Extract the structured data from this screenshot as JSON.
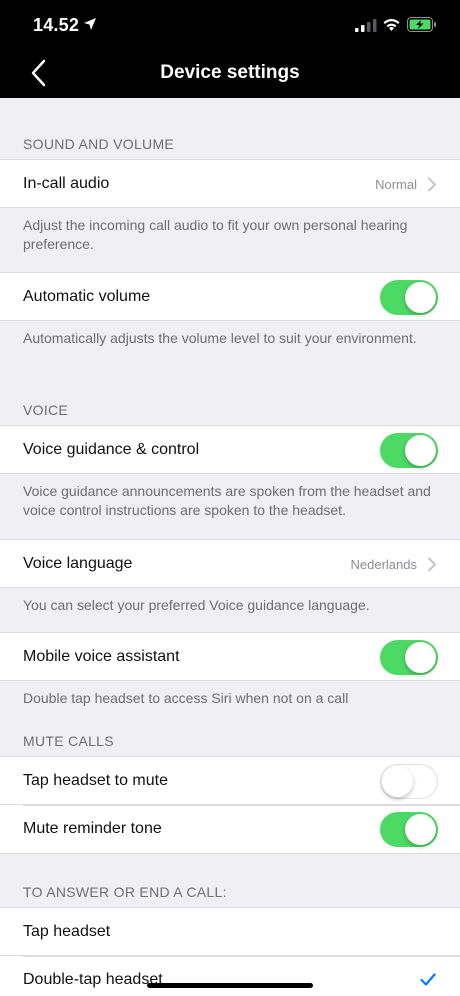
{
  "status_bar": {
    "time": "14.52"
  },
  "nav": {
    "title": "Device settings"
  },
  "sections": {
    "sound": {
      "header": "SOUND AND VOLUME",
      "in_call_audio": {
        "label": "In-call audio",
        "value": "Normal"
      },
      "in_call_note": "Adjust the incoming call audio to fit your own personal hearing preference.",
      "auto_volume": {
        "label": "Automatic volume",
        "on": true
      },
      "auto_volume_note": "Automatically adjusts the volume level to suit your environment."
    },
    "voice": {
      "header": "VOICE",
      "guidance": {
        "label": "Voice guidance & control",
        "on": true
      },
      "guidance_note": "Voice guidance announcements are spoken from the headset and voice control instructions are spoken to the headset.",
      "language": {
        "label": "Voice language",
        "value": "Nederlands"
      },
      "language_note": "You can select your preferred Voice guidance language.",
      "assistant": {
        "label": "Mobile voice assistant",
        "on": true
      },
      "assistant_note": "Double tap headset to access Siri when not on a call"
    },
    "mute": {
      "header": "MUTE CALLS",
      "tap_mute": {
        "label": "Tap headset to mute",
        "on": false
      },
      "reminder": {
        "label": "Mute reminder tone",
        "on": true
      }
    },
    "answer": {
      "header": "TO ANSWER OR END A CALL:",
      "tap": {
        "label": "Tap headset"
      },
      "double_tap": {
        "label": "Double-tap headset",
        "selected": true
      }
    }
  },
  "colors": {
    "toggle_on": "#4cd964",
    "check": "#007aff",
    "nav_bg": "#000000"
  },
  "icons": [
    "location-arrow-icon",
    "signal-icon",
    "wifi-icon",
    "battery-charging-icon",
    "back-chevron-icon",
    "chevron-right-icon",
    "checkmark-icon"
  ]
}
